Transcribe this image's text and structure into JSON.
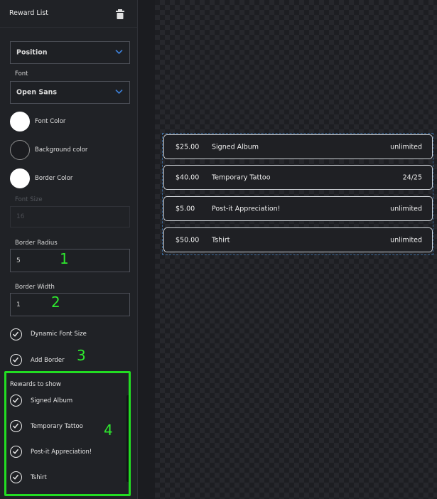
{
  "sidebar": {
    "title": "Reward List",
    "position_select": "Position",
    "font_label": "Font",
    "font_select": "Open Sans",
    "font_color_label": "Font Color",
    "background_color_label": "Background color",
    "border_color_label": "Border Color",
    "font_size_label": "Font Size",
    "font_size_value": "16",
    "border_radius_label": "Border Radius",
    "border_radius_value": "5",
    "border_width_label": "Border Width",
    "border_width_value": "1",
    "dynamic_font_size_label": "Dynamic Font Size",
    "add_border_label": "Add Border",
    "rewards_to_show_label": "Rewards to show",
    "rewards_to_show": [
      {
        "label": "Signed Album",
        "checked": true
      },
      {
        "label": "Temporary Tattoo",
        "checked": true
      },
      {
        "label": "Post-it Appreciation!",
        "checked": true
      },
      {
        "label": "Tshirt",
        "checked": true
      }
    ]
  },
  "annotations": [
    "1",
    "2",
    "3",
    "4"
  ],
  "rewards": [
    {
      "price": "$25.00",
      "name": "Signed Album",
      "availability": "unlimited"
    },
    {
      "price": "$40.00",
      "name": "Temporary Tattoo",
      "availability": "24/25"
    },
    {
      "price": "$5.00",
      "name": "Post-it Appreciation!",
      "availability": "unlimited"
    },
    {
      "price": "$50.00",
      "name": "Tshirt",
      "availability": "unlimited"
    }
  ],
  "colors": {
    "font_color": "#ffffff",
    "background_color": "#1b1c20",
    "border_color": "#ffffff",
    "highlight": "#22dd22",
    "accent": "#3d7fd6"
  },
  "icons": [
    "trash-icon",
    "chevron-down-icon",
    "check-icon"
  ]
}
